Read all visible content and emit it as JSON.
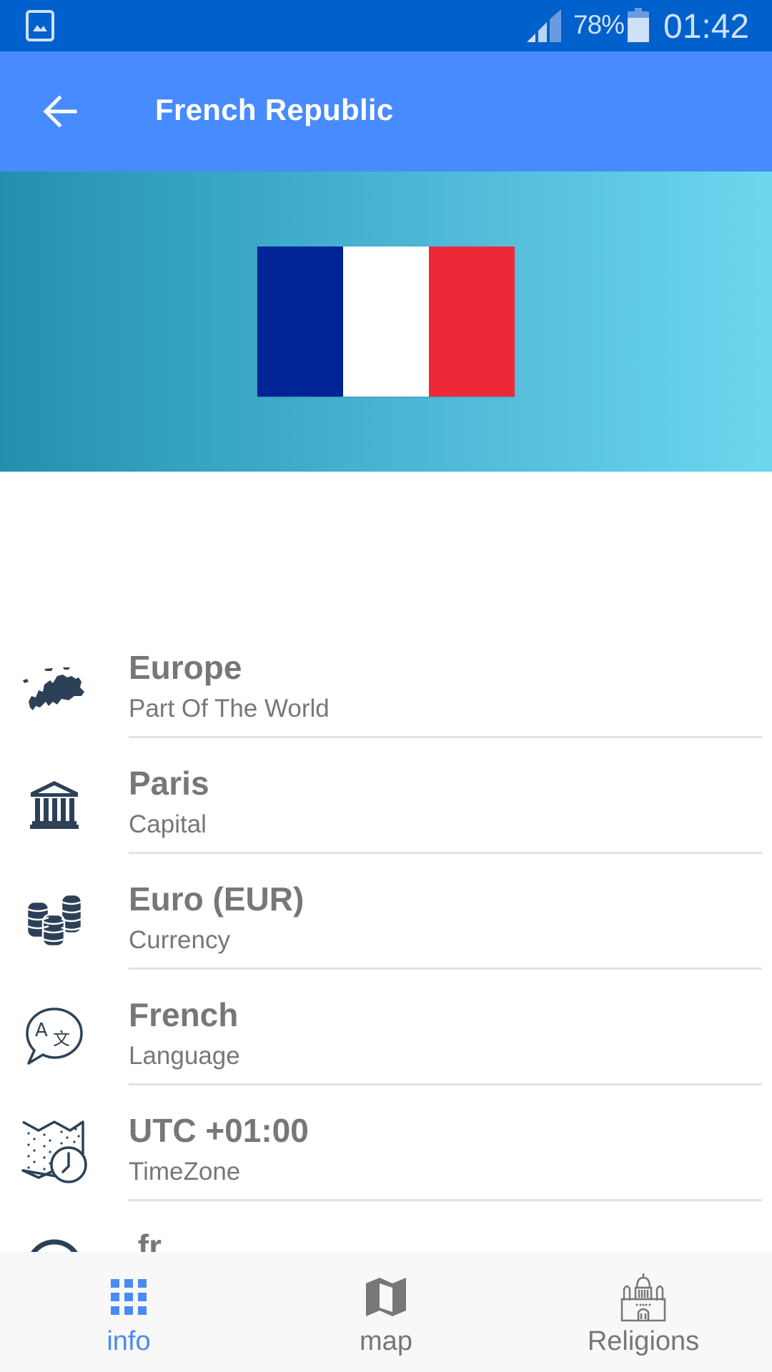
{
  "status_bar": {
    "left_icon": "gallery-notification-icon",
    "signal_icon": "cell-signal-icon",
    "battery_percent": "78%",
    "battery_icon": "battery-icon",
    "time": "01:42"
  },
  "toolbar": {
    "back_icon": "arrow-left-icon",
    "title": "French Republic"
  },
  "banner": {
    "flag_icon": "flag-france",
    "flag_colors": [
      "#002395",
      "#ffffff",
      "#ed2939"
    ]
  },
  "info_rows": [
    {
      "icon": "europe-map-icon",
      "value": "Europe",
      "label": "Part Of The World"
    },
    {
      "icon": "capital-building-icon",
      "value": "Paris",
      "label": "Capital"
    },
    {
      "icon": "coins-icon",
      "value": "Euro (EUR)",
      "label": "Currency"
    },
    {
      "icon": "translate-icon",
      "value": "French",
      "label": "Language"
    },
    {
      "icon": "map-clock-icon",
      "value": "UTC +01:00",
      "label": "TimeZone"
    },
    {
      "icon": "at-sign-icon",
      "value": ".fr",
      "label": ""
    }
  ],
  "bottom_nav": {
    "items": [
      {
        "icon": "grid-icon",
        "label": "info",
        "active": true
      },
      {
        "icon": "map-icon",
        "label": "map",
        "active": false
      },
      {
        "icon": "church-icon",
        "label": "Religions",
        "active": false
      }
    ]
  },
  "colors": {
    "status_bar": "#0060cc",
    "toolbar": "#478bff",
    "accent": "#4a8af4",
    "icon_dark": "#2c4158",
    "text_gray": "#777777",
    "nav_bg": "#f8f8f8"
  }
}
